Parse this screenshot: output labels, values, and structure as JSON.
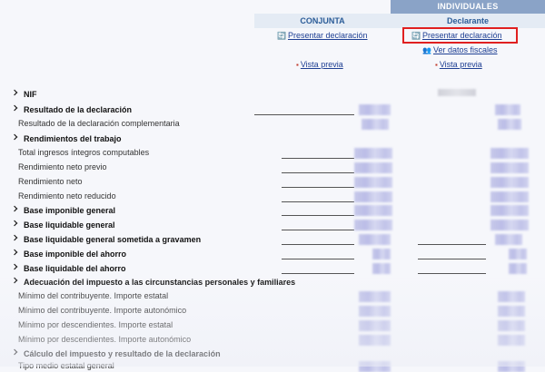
{
  "header": {
    "individuales": "INDIVIDUALES",
    "conjunta": "CONJUNTA",
    "declarante": "Declarante"
  },
  "links": {
    "conjunta_presentar": "Presentar declaración",
    "conjunta_vista": "Vista previa",
    "declarante_presentar": "Presentar declaración",
    "declarante_ver_datos": "Ver datos fiscales",
    "declarante_vista": "Vista previa"
  },
  "rows": [
    {
      "label": "NIF",
      "type": "section"
    },
    {
      "label": "Resultado de la declaración",
      "type": "section"
    },
    {
      "label": "Resultado de la declaración complementaria",
      "type": "sub"
    },
    {
      "label": "Rendimientos del trabajo",
      "type": "section"
    },
    {
      "label": "Total ingresos íntegros computables",
      "type": "sub"
    },
    {
      "label": "Rendimiento neto previo",
      "type": "sub"
    },
    {
      "label": "Rendimiento neto",
      "type": "sub"
    },
    {
      "label": "Rendimiento neto reducido",
      "type": "sub"
    },
    {
      "label": "Base imponible general",
      "type": "section"
    },
    {
      "label": "Base liquidable general",
      "type": "section"
    },
    {
      "label": "Base liquidable general sometida a gravamen",
      "type": "section"
    },
    {
      "label": "Base imponible del ahorro",
      "type": "section"
    },
    {
      "label": "Base liquidable del ahorro",
      "type": "section"
    },
    {
      "label": "Adecuación del impuesto a las circunstancias personales y familiares",
      "type": "section"
    },
    {
      "label": "Mínimo del contribuyente. Importe estatal",
      "type": "sub"
    },
    {
      "label": "Mínimo del contribuyente. Importe autonómico",
      "type": "sub"
    },
    {
      "label": "Mínimo por descendientes. Importe estatal",
      "type": "sub"
    },
    {
      "label": "Mínimo por descendientes. Importe autonómico",
      "type": "sub"
    },
    {
      "label": "Cálculo del impuesto y resultado de la declaración",
      "type": "section"
    },
    {
      "label": "Tipo medio estatal general",
      "type": "sub"
    }
  ],
  "colors": {
    "header_dark": "#8aa3c7",
    "header_light": "#e4ebf4",
    "link": "#1e3f93",
    "highlight": "#e02020"
  }
}
